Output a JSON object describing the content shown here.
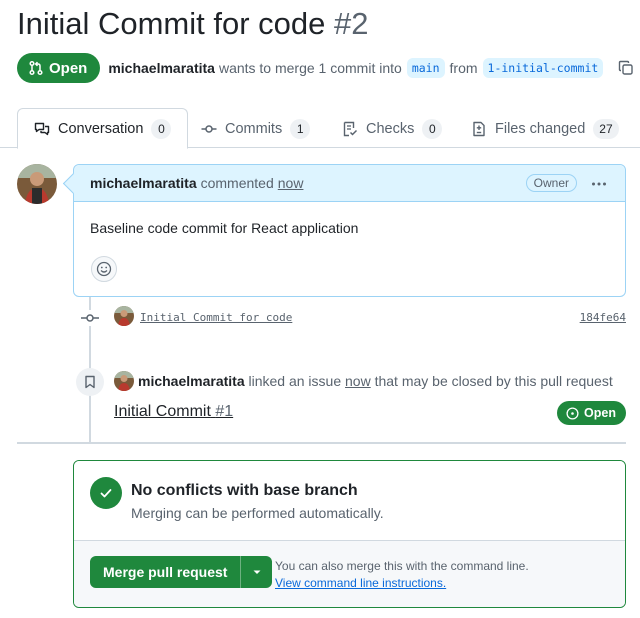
{
  "pr": {
    "title": "Initial Commit for code",
    "number": "#2",
    "state": "Open",
    "author": "michaelmaratita",
    "merge_text": "wants to merge 1 commit into",
    "base_branch": "main",
    "from_text": "from",
    "head_branch": "1-initial-commit"
  },
  "tabs": [
    {
      "label": "Conversation",
      "count": "0",
      "icon": "comment-discussion-icon",
      "active": true
    },
    {
      "label": "Commits",
      "count": "1",
      "icon": "git-commit-icon"
    },
    {
      "label": "Checks",
      "count": "0",
      "icon": "checklist-icon"
    },
    {
      "label": "Files changed",
      "count": "27",
      "icon": "file-diff-icon"
    }
  ],
  "comment": {
    "author": "michaelmaratita",
    "action": "commented",
    "time": "now",
    "role": "Owner",
    "body": "Baseline code commit for React application"
  },
  "commit": {
    "message": "Initial Commit for code",
    "sha": "184fe64"
  },
  "linked_issue": {
    "author": "michaelmaratita",
    "text_before": "linked an issue",
    "time": "now",
    "text_after": "that may be closed by this pull request",
    "issue_title": "Initial Commit",
    "issue_number": "#1",
    "state": "Open"
  },
  "merge": {
    "title": "No conflicts with base branch",
    "subtitle": "Merging can be performed automatically.",
    "button_label": "Merge pull request",
    "hint": "You can also merge this with the command line.",
    "hint_link": "View command line instructions."
  },
  "colors": {
    "green": "#1f883d",
    "blue_bg": "#ddf4ff",
    "blue_border": "#9cd3f5",
    "link": "#0969da"
  }
}
